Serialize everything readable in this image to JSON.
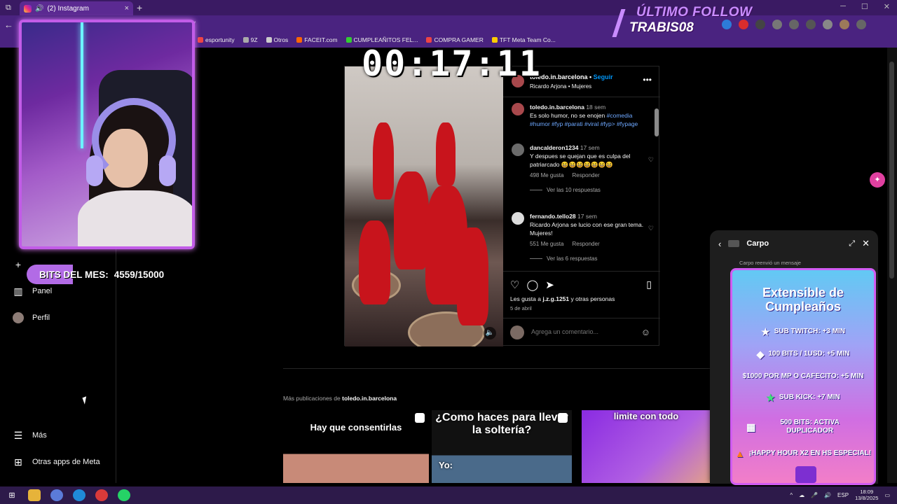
{
  "browser": {
    "tab_title": "(2) Instagram",
    "tab_close": "×",
    "new_tab": "+",
    "url_fragment": "/",
    "bookmarks": [
      "esportunity",
      "9Z",
      "Otros",
      "FACEIT.com",
      "CUMPLEAÑITOS FEL...",
      "COMPRA GAMER",
      "TFT Meta Team Co..."
    ]
  },
  "overlay": {
    "timer": "00:17:11",
    "follow_label": "ÚLTIMO FOLLOW",
    "follow_name": "TRABIS08",
    "bits_label": "BITS DEL MES:",
    "bits_value": "4559/15000"
  },
  "sidebar": {
    "items": [
      {
        "label": "Panel",
        "icon": "chart-icon"
      },
      {
        "label": "Perfil",
        "icon": "avatar"
      },
      {
        "label": "Más",
        "icon": "menu-icon"
      },
      {
        "label": "Otras apps de Meta",
        "icon": "meta-apps-icon"
      }
    ]
  },
  "post": {
    "username": "toledo.in.barcelona",
    "follow": "Seguir",
    "audio": "Ricardo Arjona • Mujeres",
    "caption_user": "toledo.in.barcelona",
    "caption_time": "18 sem",
    "caption_text": "Es solo humor, no se enojen",
    "caption_tags": "#comedia #humor #fyp #parati #viral #fyp> #fypage",
    "comments": [
      {
        "user": "dancalderon1234",
        "time": "17 sem",
        "text": "Y despues se quejan que es culpa del patriarcado 😆😆😆😆😆😆😆",
        "likes": "498 Me gusta",
        "reply": "Responder",
        "replies": "Ver las 10 respuestas"
      },
      {
        "user": "fernando.tello28",
        "time": "17 sem",
        "text": "Ricardo Arjona se lucio con ese gran tema. Mujeres!",
        "likes": "551 Me gusta",
        "reply": "Responder",
        "replies": "Ver las 6 respuestas"
      }
    ],
    "liked_by_prefix": "Les gusta a",
    "liked_by_user": "j.z.g.1251",
    "liked_by_suffix": "y otras personas",
    "date": "5 de abril",
    "comment_placeholder": "Agrega un comentario..."
  },
  "more_posts": {
    "prefix": "Más publicaciones de",
    "user": "toledo.in.barcelona",
    "thumbs": [
      {
        "caption": "Hay que consentirlas"
      },
      {
        "caption": "¿Como haces para llevar la soltería?",
        "sub": "Yo:"
      },
      {
        "caption": "limite con todo"
      }
    ]
  },
  "chat": {
    "name": "Carpo",
    "subtitle": "Carpo reenvió un mensaje"
  },
  "birthday_card": {
    "title": "Extensible de Cumpleaños",
    "perks": [
      "SUB TWITCH: +3 MIN",
      "100 BITS / 1USD: +5 MIN",
      "$1000 POR MP O CAFECITO: +5 MIN",
      "SUB KICK: +7 MIN",
      "500 BITS: ACTIVA DUPLICADOR",
      "¡HAPPY HOUR X2 EN HS ESPECIAL!"
    ]
  },
  "taskbar": {
    "lang": "ESP",
    "time": "18:09",
    "date": "13/8/2025"
  }
}
